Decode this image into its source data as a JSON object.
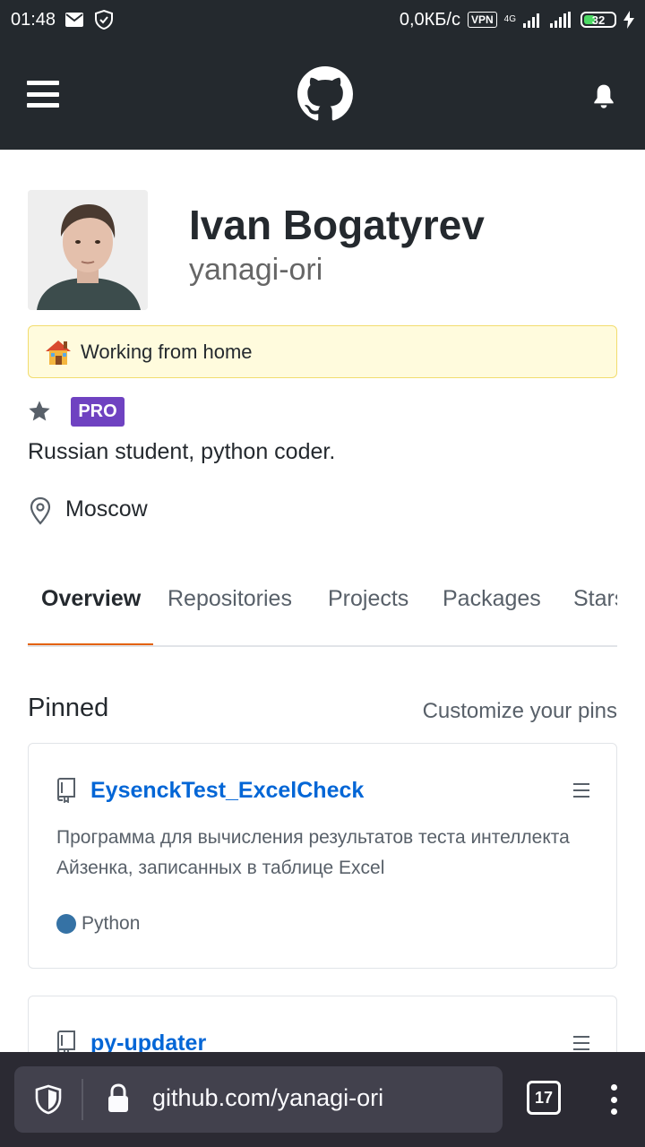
{
  "status_bar": {
    "time": "01:48",
    "net_speed": "0,0КБ/с",
    "vpn_label": "VPN",
    "network_type": "4G",
    "battery": "32"
  },
  "header": {
    "menu_icon": "hamburger-icon",
    "logo_icon": "github-octocat-icon",
    "notifications_icon": "bell-icon"
  },
  "profile": {
    "name": "Ivan Bogatyrev",
    "login": "yanagi-ori",
    "status_emoji": "house-emoji",
    "status_text": "Working from home",
    "badge": "PRO",
    "bio": "Russian student, python coder.",
    "location": "Moscow"
  },
  "tabs": [
    {
      "label": "Overview",
      "active": true
    },
    {
      "label": "Repositories",
      "active": false
    },
    {
      "label": "Projects",
      "active": false
    },
    {
      "label": "Packages",
      "active": false
    },
    {
      "label": "Stars",
      "active": false
    }
  ],
  "pinned": {
    "title": "Pinned",
    "customize_label": "Customize your pins",
    "repos": [
      {
        "name": "EysenckTest_ExcelCheck",
        "description": "Программа для вычисления результатов теста интеллекта Айзенка, записанных в таблице Excel",
        "language": "Python",
        "language_color": "#3572A5"
      },
      {
        "name": "py-updater"
      }
    ]
  },
  "browser": {
    "url": "github.com/yanagi-ori",
    "tab_count": "17"
  },
  "colors": {
    "header_bg": "#24292e",
    "link": "#0366d6",
    "tab_accent": "#e36209",
    "pro_badge": "#6f42c1",
    "status_bg": "#fffbdd"
  }
}
